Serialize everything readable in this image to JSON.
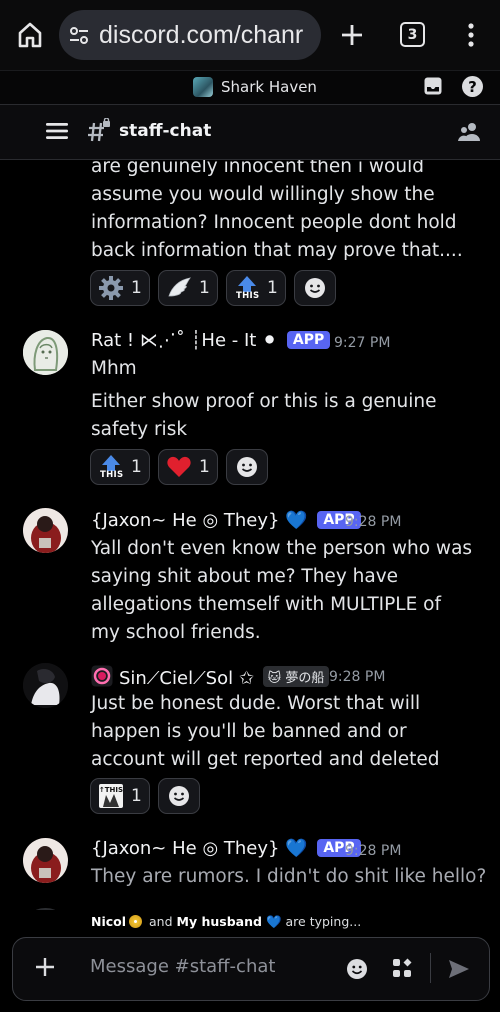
{
  "browser": {
    "url": "discord.com/chanr",
    "tab_count": "3"
  },
  "server": {
    "name": "Shark Haven"
  },
  "channel": {
    "name": "staff-chat",
    "hash": "#"
  },
  "continuation": {
    "lines": [
      "are genuinely innocent then i would",
      "assume you would willingly show the",
      "information? Innocent people dont hold",
      "back information that may prove that...."
    ],
    "reactions": [
      {
        "emoji": "gear-icon",
        "count": "1"
      },
      {
        "emoji": "wing-icon",
        "count": "1"
      },
      {
        "emoji": "this-arrow-icon",
        "count": "1"
      }
    ]
  },
  "messages": [
    {
      "author": "Rat ! ⋉⋰˚ ┊He - It ⚫",
      "badge": "APP",
      "time": "9:27 PM",
      "lines": [
        "Mhm"
      ],
      "lines2": [
        "Either show proof or this is a genuine",
        "safety risk"
      ],
      "reactions": [
        {
          "emoji": "this-arrow-icon",
          "count": "1"
        },
        {
          "emoji": "heart-icon",
          "count": "1"
        }
      ]
    },
    {
      "author": "{Jaxon~ He ◎ They} 💙",
      "badge": "APP",
      "time": "9:28 PM",
      "lines": [
        "Yall don't even know the person who was",
        "saying shit about me? They have",
        "allegations themself with MULTIPLE of",
        "my school friends."
      ]
    },
    {
      "author": "Sin⟋Ciel⟋Sol ✩",
      "tag": "夢の船",
      "time": "9:28 PM",
      "lines": [
        "Just be honest dude. Worst that will",
        "happen is you'll be banned and or",
        "account will get reported and deleted"
      ],
      "reactions": [
        {
          "emoji": "this-sticker-icon",
          "count": "1"
        }
      ]
    },
    {
      "author": "{Jaxon~ He ◎ They} 💙",
      "badge": "APP",
      "time": "9:28 PM",
      "lines": [
        "They are rumors. I didn't do shit like hello?"
      ]
    }
  ],
  "typing": {
    "user1": "Nicol",
    "middle": "and",
    "user2": "My husband",
    "suffix": "are typing..."
  },
  "composer": {
    "placeholder": "Message #staff-chat"
  },
  "colors": {
    "accent": "#5865f2",
    "background": "#000000",
    "heart": "#e0202e"
  }
}
